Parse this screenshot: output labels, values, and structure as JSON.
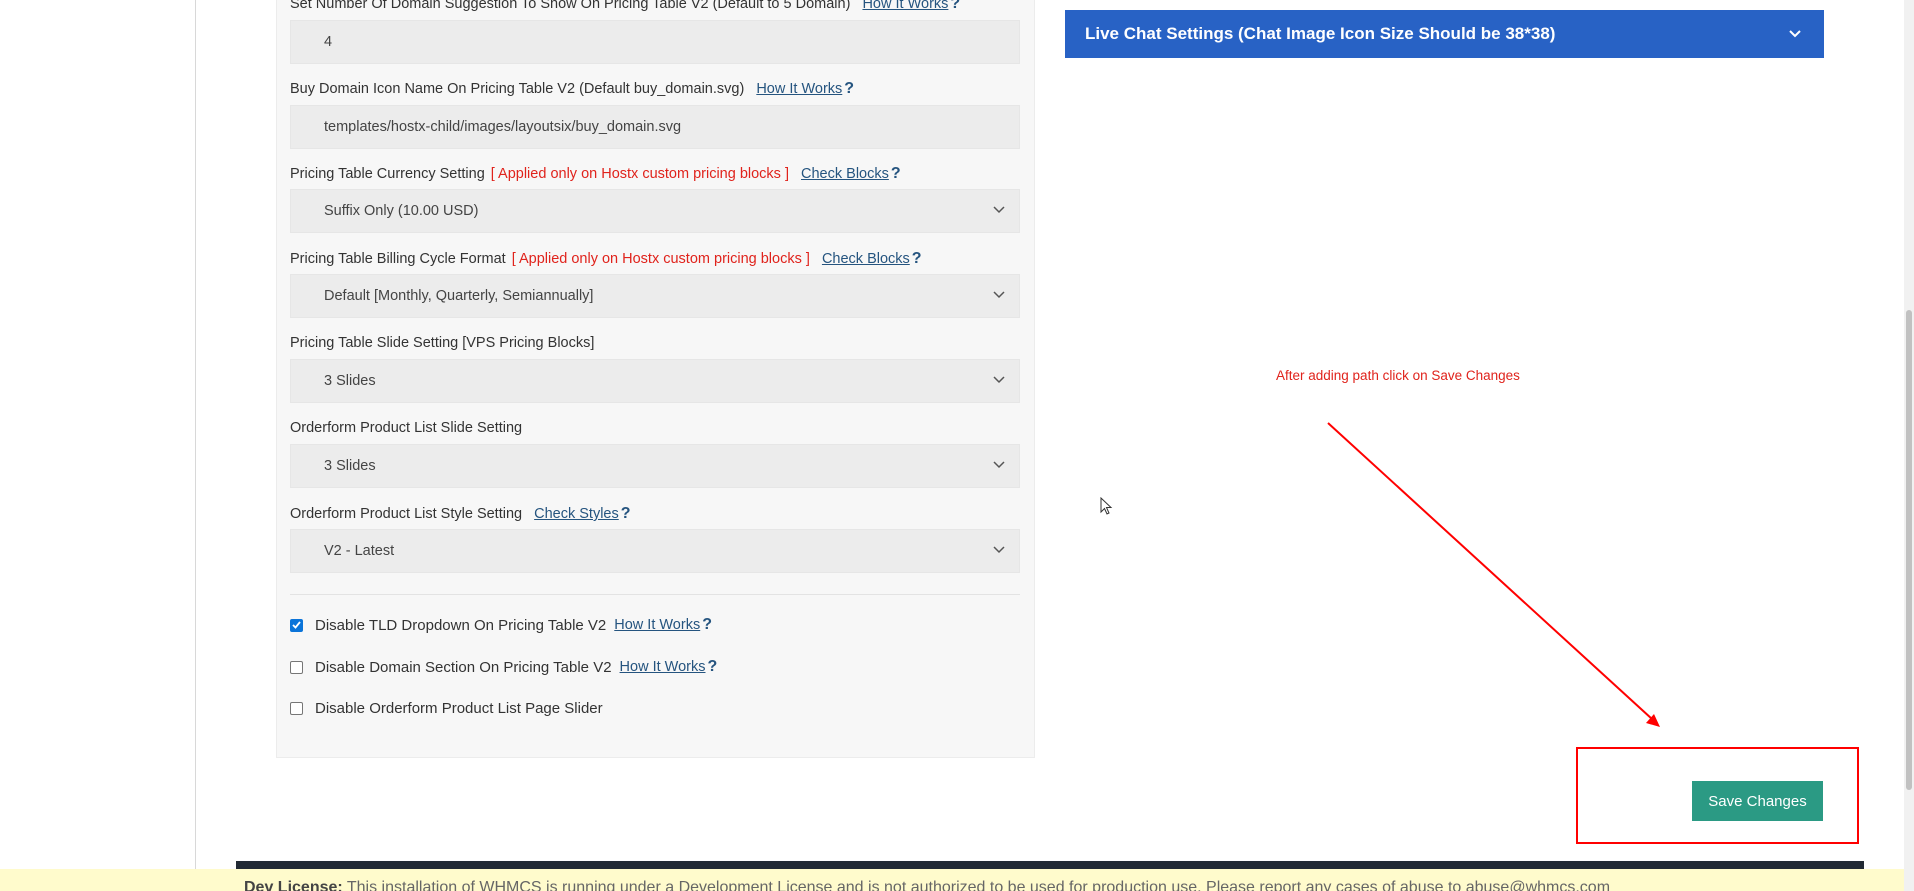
{
  "fields": {
    "domain_suggestion": {
      "label": "Set Number Of Domain Suggestion To Show On Pricing Table V2 (Default to 5 Domain)",
      "link": "How It Works",
      "value": "4"
    },
    "buy_domain_icon": {
      "label": "Buy Domain Icon Name On Pricing Table V2 (Default buy_domain.svg)",
      "link": "How It Works",
      "value": "templates/hostx-child/images/layoutsix/buy_domain.svg"
    },
    "currency_setting": {
      "label": "Pricing Table Currency Setting",
      "note": "[ Applied only on Hostx custom pricing blocks ]",
      "link": "Check Blocks",
      "value": "Suffix Only (10.00 USD)"
    },
    "billing_cycle": {
      "label": "Pricing Table Billing Cycle Format",
      "note": "[ Applied only on Hostx custom pricing blocks ]",
      "link": "Check Blocks",
      "value": "Default [Monthly, Quarterly, Semiannually]"
    },
    "slide_setting": {
      "label": "Pricing Table Slide Setting [VPS Pricing Blocks]",
      "value": "3 Slides"
    },
    "orderform_slide": {
      "label": "Orderform Product List Slide Setting",
      "value": "3 Slides"
    },
    "orderform_style": {
      "label": "Orderform Product List Style Setting",
      "link": "Check Styles",
      "value": "V2 - Latest"
    }
  },
  "checkboxes": [
    {
      "label": "Disable TLD Dropdown On Pricing Table V2",
      "link": "How It Works",
      "checked": true
    },
    {
      "label": "Disable Domain Section On Pricing Table V2",
      "link": "How It Works",
      "checked": false
    },
    {
      "label": "Disable Orderform Product List Page Slider",
      "link": "",
      "checked": false
    }
  ],
  "help_glyph": "?",
  "live_chat": {
    "title": "Live Chat Settings (Chat Image Icon Size Should be 38*38)"
  },
  "annotation": {
    "text": "After adding path click on Save Changes",
    "color": "#e0231c"
  },
  "save_button": {
    "label": "Save Changes",
    "color": "#2b9a84"
  },
  "dev_license": {
    "prefix": "Dev License:",
    "text": "This installation of WHMCS is running under a Development License and is not authorized to be used for production use. Please report any cases of abuse to abuse@whmcs.com"
  },
  "colors": {
    "accent": "#2862c5",
    "link": "#25547f",
    "warning": "#e0231c",
    "highlight_box": "#ff0000"
  }
}
